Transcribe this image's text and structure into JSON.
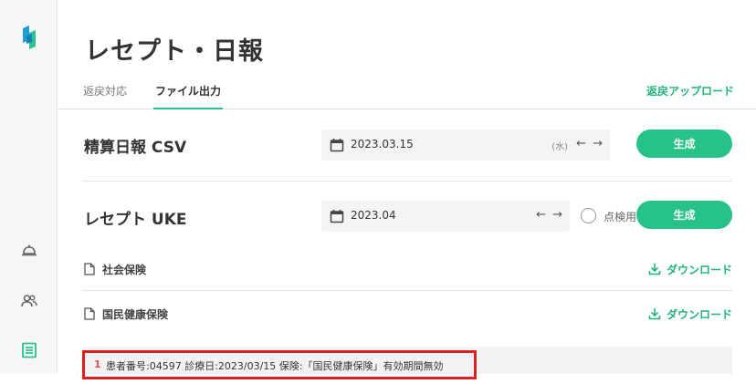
{
  "app": {
    "title": "レセプト・日報"
  },
  "tabs": [
    {
      "label": "返戻対応"
    },
    {
      "label": "ファイル出力"
    }
  ],
  "header": {
    "upload_label": "返戻アップロード"
  },
  "csv_section": {
    "title": "精算日報 CSV",
    "date": "2023.03.15",
    "weekday": "(水)",
    "generate_label": "生成"
  },
  "uke_section": {
    "title": "レセプト UKE",
    "date": "2023.04",
    "checkbox_label": "点検用",
    "generate_label": "生成"
  },
  "files": [
    {
      "name": "社会保険",
      "download_label": "ダウンロード"
    },
    {
      "name": "国民健康保険",
      "download_label": "ダウンロード"
    }
  ],
  "errors": [
    {
      "number": "1",
      "message": "患者番号:04597 診療日:2023/03/15 保険:「国民健康保険」有効期間無効"
    }
  ],
  "colors": {
    "accent": "#26c287",
    "error": "#e01e1e"
  },
  "icons": [
    "logo-icon",
    "bell-icon",
    "users-icon",
    "document-list-icon",
    "calendar-icon",
    "arrow-left-icon",
    "arrow-right-icon",
    "file-icon",
    "download-icon"
  ]
}
